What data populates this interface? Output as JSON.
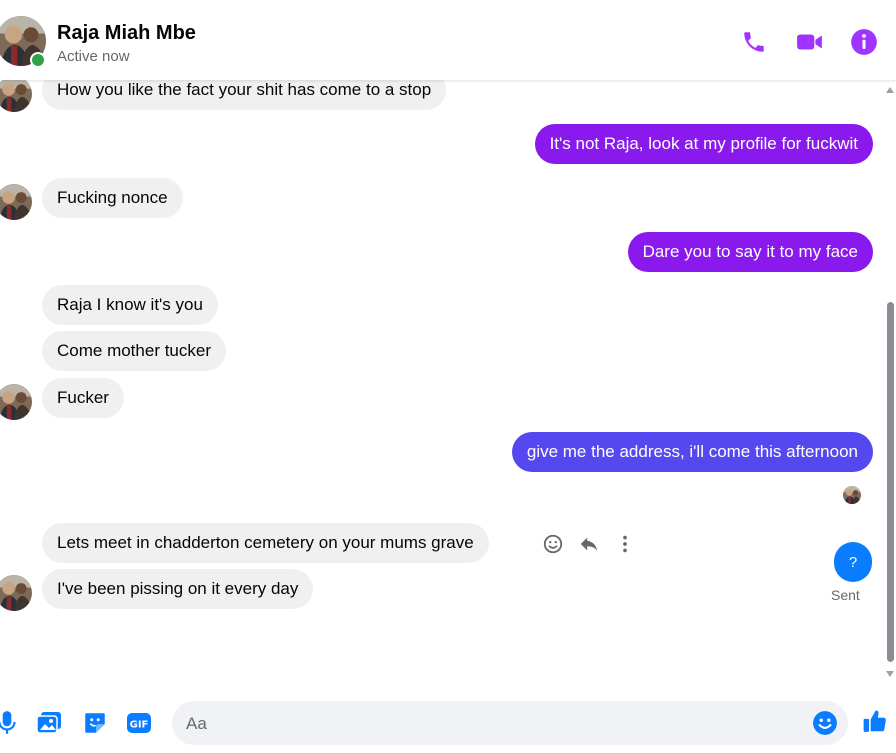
{
  "header": {
    "contact_name": "Raja Miah Mbe",
    "status": "Active now"
  },
  "messages": [
    {
      "side": "in",
      "text": "How you like the fact your shit has come to a stop"
    },
    {
      "side": "out",
      "text": "It's not Raja, look at my profile for fuckwit"
    },
    {
      "side": "in",
      "text": "Fucking nonce"
    },
    {
      "side": "out",
      "text": "Dare you to say it to my face"
    },
    {
      "side": "in",
      "text": "Raja I know it's you"
    },
    {
      "side": "in",
      "text": "Come mother tucker"
    },
    {
      "side": "in",
      "text": "Fucker"
    },
    {
      "side": "out",
      "text": "give me the address, i'll come this afternoon"
    },
    {
      "side": "in",
      "text": "Lets meet in chadderton cemetery on your mums grave"
    },
    {
      "side": "in",
      "text": "I've been pissing on it every day"
    }
  ],
  "sent_bubble": {
    "text": "?",
    "status": "Sent"
  },
  "composer": {
    "placeholder": "Aa"
  },
  "colors": {
    "accent": "#a033ff",
    "outgoing_purple": "#8a19ed",
    "outgoing_blue": "#5548ee",
    "incoming": "#f0f0f0",
    "sent_bubble": "#0a7cff",
    "composer_icons": "#0a7cff",
    "online": "#31a24c"
  },
  "icons": {
    "header": [
      "phone-icon",
      "video-camera-icon",
      "info-icon"
    ],
    "message_actions": [
      "react-emoji-icon",
      "reply-icon",
      "more-options-icon"
    ],
    "composer": [
      "microphone-icon",
      "image-icon",
      "sticker-icon",
      "gif-icon",
      "emoji-icon",
      "thumbs-up-icon"
    ]
  }
}
